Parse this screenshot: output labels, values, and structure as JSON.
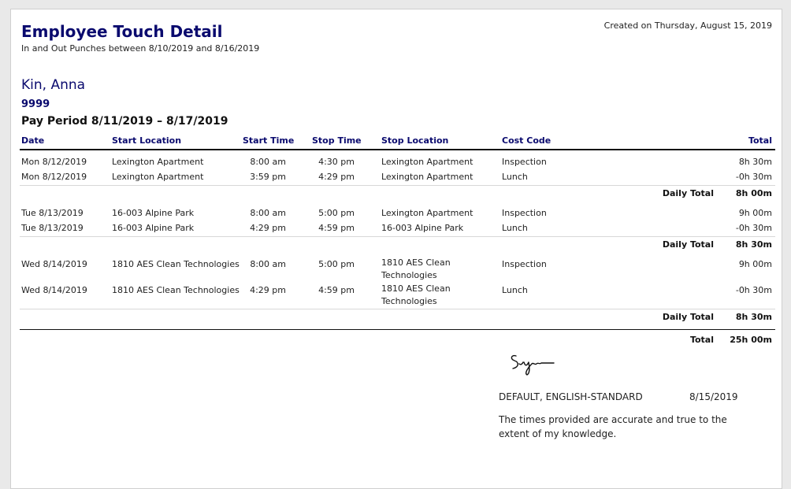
{
  "header": {
    "title": "Employee Touch Detail",
    "subtitle": "In and Out Punches between 8/10/2019 and 8/16/2019",
    "created": "Created on Thursday, August 15, 2019"
  },
  "employee": {
    "name": "Kin, Anna",
    "id": "9999",
    "pay_period": "Pay Period 8/11/2019 – 8/17/2019"
  },
  "table": {
    "columns": {
      "date": "Date",
      "start_location": "Start Location",
      "start_time": "Start Time",
      "stop_time": "Stop Time",
      "stop_location": "Stop Location",
      "cost_code": "Cost Code",
      "total": "Total"
    },
    "rows": [
      {
        "date": "Mon 8/12/2019",
        "start_location": "Lexington Apartment",
        "start_time": "8:00 am",
        "stop_time": "4:30 pm",
        "stop_location": "Lexington Apartment",
        "cost_code": "Inspection",
        "total": "8h 30m"
      },
      {
        "date": "Mon 8/12/2019",
        "start_location": "Lexington Apartment",
        "start_time": "3:59 pm",
        "stop_time": "4:29 pm",
        "stop_location": "Lexington Apartment",
        "cost_code": "Lunch",
        "total": "-0h 30m"
      },
      {
        "date": "Tue 8/13/2019",
        "start_location": "16-003 Alpine Park",
        "start_time": "8:00 am",
        "stop_time": "5:00 pm",
        "stop_location": "Lexington Apartment",
        "cost_code": "Inspection",
        "total": "9h 00m"
      },
      {
        "date": "Tue 8/13/2019",
        "start_location": "16-003 Alpine Park",
        "start_time": "4:29 pm",
        "stop_time": "4:59 pm",
        "stop_location": "16-003 Alpine Park",
        "cost_code": "Lunch",
        "total": "-0h 30m"
      },
      {
        "date": "Wed 8/14/2019",
        "start_location": "1810 AES Clean Technologies",
        "start_time": "8:00 am",
        "stop_time": "5:00 pm",
        "stop_location": "1810 AES Clean Technologies",
        "cost_code": "Inspection",
        "total": "9h 00m"
      },
      {
        "date": "Wed 8/14/2019",
        "start_location": "1810 AES Clean Technologies",
        "start_time": "4:29 pm",
        "stop_time": "4:59 pm",
        "stop_location": "1810 AES Clean Technologies",
        "cost_code": "Lunch",
        "total": "-0h 30m"
      }
    ],
    "daily_totals": [
      {
        "label": "Daily Total",
        "value": "8h 00m"
      },
      {
        "label": "Daily Total",
        "value": "8h 30m"
      },
      {
        "label": "Daily Total",
        "value": "8h 30m"
      }
    ],
    "grand_total": {
      "label": "Total",
      "value": "25h 00m"
    }
  },
  "signature": {
    "image_text": "Sign",
    "name": "DEFAULT, ENGLISH-STANDARD",
    "date": "8/15/2019",
    "statement": "The times provided are accurate and true to the extent of my knowledge."
  }
}
